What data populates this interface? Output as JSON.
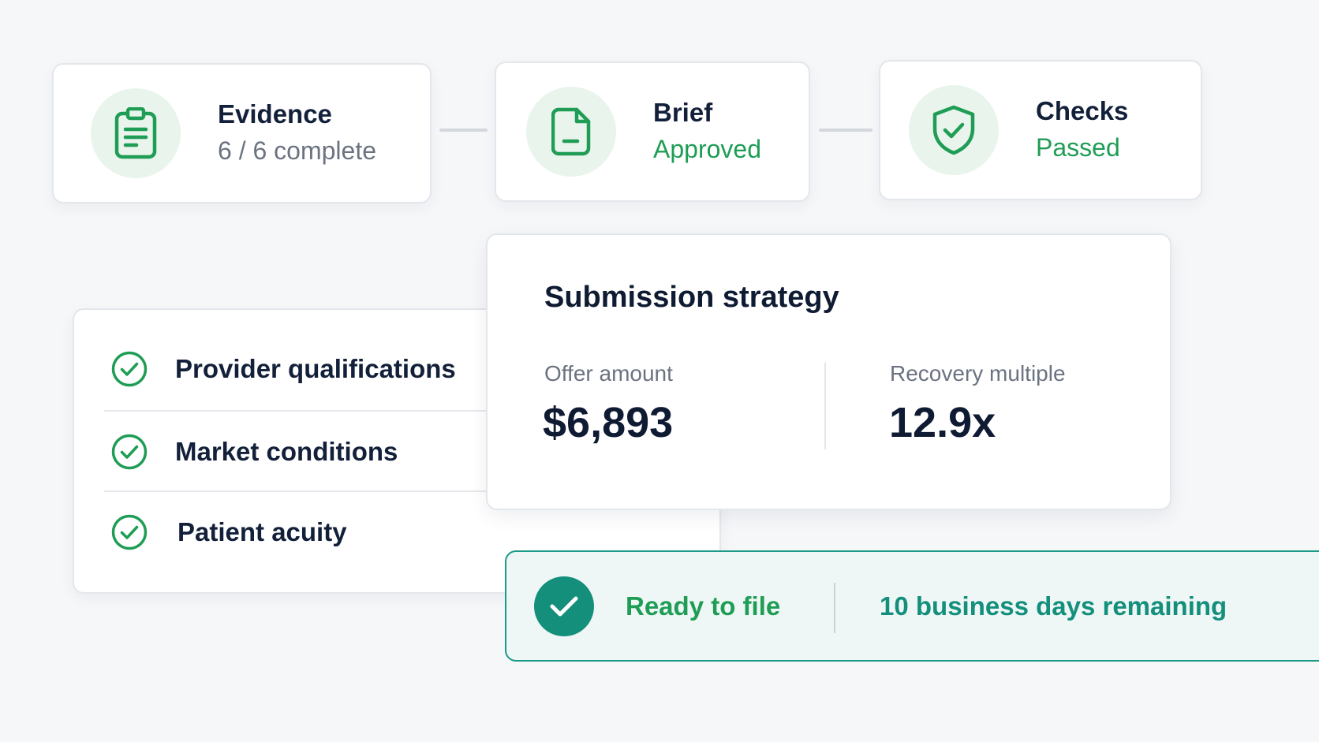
{
  "pipeline": {
    "steps": [
      {
        "title": "Evidence",
        "status": "6 / 6 complete",
        "icon": "clipboard-icon"
      },
      {
        "title": "Brief",
        "status": "Approved",
        "icon": "document-icon"
      },
      {
        "title": "Checks",
        "status": "Passed",
        "icon": "shield-check-icon"
      }
    ]
  },
  "checklist": {
    "items": [
      {
        "label": "Provider qualifications",
        "icon": "check-circle-icon"
      },
      {
        "label": "Market conditions",
        "icon": "check-circle-icon"
      },
      {
        "label": "Patient acuity",
        "icon": "check-circle-icon"
      }
    ]
  },
  "strategy": {
    "title": "Submission strategy",
    "offer_label": "Offer amount",
    "offer_value": "$6,893",
    "multiple_label": "Recovery multiple",
    "multiple_value": "12.9x"
  },
  "status_banner": {
    "status": "Ready to file",
    "deadline": "10 business days remaining",
    "icon": "check-badge-icon"
  },
  "colors": {
    "accent_green": "#1f9d55",
    "teal": "#138f7c",
    "icon_bg": "#e8f4ec",
    "background": "#f6f7f9"
  }
}
